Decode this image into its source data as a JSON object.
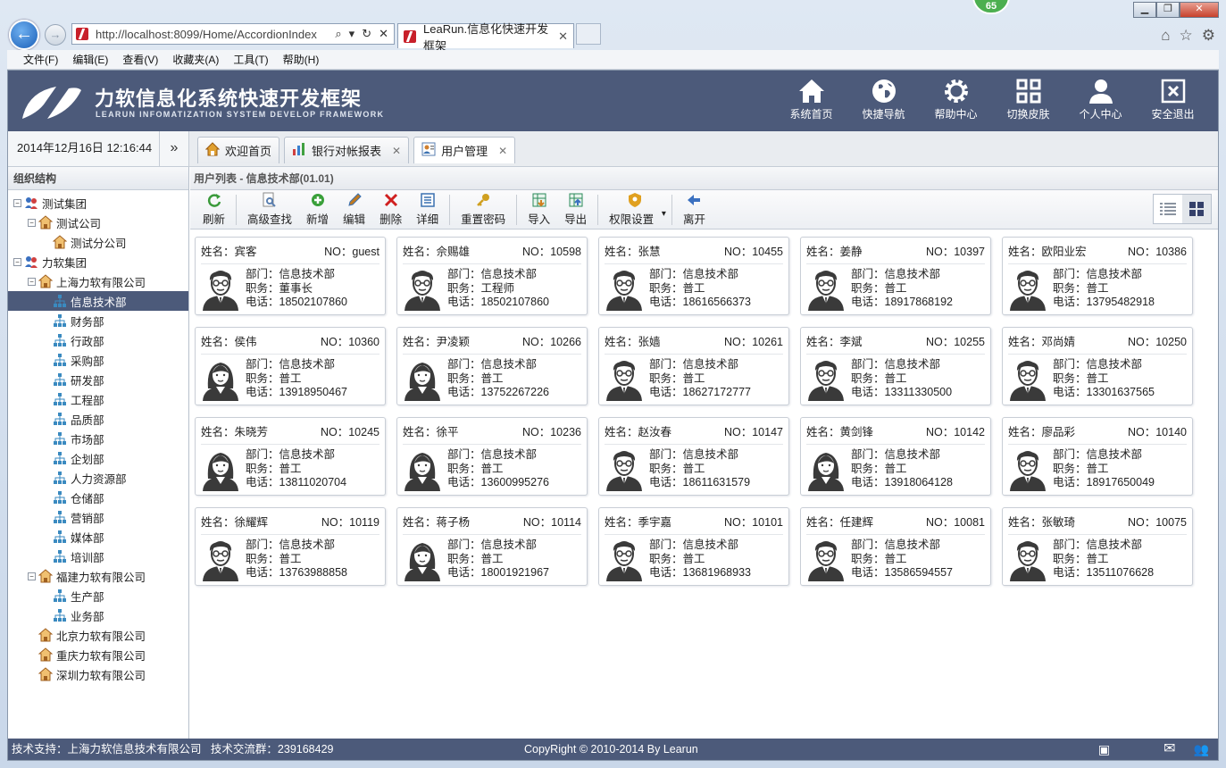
{
  "browser": {
    "url": "http://localhost:8099/Home/AccordionIndex",
    "tab_title": "LeaRun.信息化快速开发框架",
    "badge": "65",
    "menu": [
      "文件(F)",
      "编辑(E)",
      "查看(V)",
      "收藏夹(A)",
      "工具(T)",
      "帮助(H)"
    ]
  },
  "header": {
    "title": "力软信息化系统快速开发框架",
    "subtitle": "LEARUN INFOMATIZATION SYSTEM DEVELOP FRAMEWORK",
    "nav": [
      {
        "label": "系统首页",
        "icon": "home-icon"
      },
      {
        "label": "快捷导航",
        "icon": "globe-icon"
      },
      {
        "label": "帮助中心",
        "icon": "gear-icon"
      },
      {
        "label": "切换皮肤",
        "icon": "grid-icon"
      },
      {
        "label": "个人中心",
        "icon": "user-icon"
      },
      {
        "label": "安全退出",
        "icon": "exit-icon"
      }
    ]
  },
  "datetime": "2014年12月16日 12:16:44",
  "tabs": [
    {
      "label": "欢迎首页",
      "closable": false
    },
    {
      "label": "银行对帐报表",
      "closable": true
    },
    {
      "label": "用户管理",
      "closable": true
    }
  ],
  "sidebar": {
    "title": "组织结构",
    "nodes": [
      {
        "label": "测试集团",
        "level": 0,
        "toggle": "-",
        "type": "group"
      },
      {
        "label": "测试公司",
        "level": 1,
        "toggle": "-",
        "type": "company"
      },
      {
        "label": "测试分公司",
        "level": 2,
        "toggle": "",
        "type": "company"
      },
      {
        "label": "力软集团",
        "level": 0,
        "toggle": "-",
        "type": "group"
      },
      {
        "label": "上海力软有限公司",
        "level": 1,
        "toggle": "-",
        "type": "company"
      },
      {
        "label": "信息技术部",
        "level": 2,
        "toggle": "",
        "type": "dept",
        "selected": true
      },
      {
        "label": "财务部",
        "level": 2,
        "toggle": "",
        "type": "dept"
      },
      {
        "label": "行政部",
        "level": 2,
        "toggle": "",
        "type": "dept"
      },
      {
        "label": "采购部",
        "level": 2,
        "toggle": "",
        "type": "dept"
      },
      {
        "label": "研发部",
        "level": 2,
        "toggle": "",
        "type": "dept"
      },
      {
        "label": "工程部",
        "level": 2,
        "toggle": "",
        "type": "dept"
      },
      {
        "label": "品质部",
        "level": 2,
        "toggle": "",
        "type": "dept"
      },
      {
        "label": "市场部",
        "level": 2,
        "toggle": "",
        "type": "dept"
      },
      {
        "label": "企划部",
        "level": 2,
        "toggle": "",
        "type": "dept"
      },
      {
        "label": "人力资源部",
        "level": 2,
        "toggle": "",
        "type": "dept"
      },
      {
        "label": "仓储部",
        "level": 2,
        "toggle": "",
        "type": "dept"
      },
      {
        "label": "营销部",
        "level": 2,
        "toggle": "",
        "type": "dept"
      },
      {
        "label": "媒体部",
        "level": 2,
        "toggle": "",
        "type": "dept"
      },
      {
        "label": "培训部",
        "level": 2,
        "toggle": "",
        "type": "dept"
      },
      {
        "label": "福建力软有限公司",
        "level": 1,
        "toggle": "-",
        "type": "company"
      },
      {
        "label": "生产部",
        "level": 2,
        "toggle": "",
        "type": "dept"
      },
      {
        "label": "业务部",
        "level": 2,
        "toggle": "",
        "type": "dept"
      },
      {
        "label": "北京力软有限公司",
        "level": 1,
        "toggle": "",
        "type": "company"
      },
      {
        "label": "重庆力软有限公司",
        "level": 1,
        "toggle": "",
        "type": "company"
      },
      {
        "label": "深圳力软有限公司",
        "level": 1,
        "toggle": "",
        "type": "company"
      }
    ]
  },
  "breadcrumb": "用户列表 - 信息技术部(01.01)",
  "toolbar": [
    {
      "label": "刷新",
      "icon": "refresh-icon",
      "color": "#3a9a3a"
    },
    {
      "sep": true
    },
    {
      "label": "高级查找",
      "icon": "search-icon",
      "color": "#5a7fb0"
    },
    {
      "label": "新增",
      "icon": "add-icon",
      "color": "#3aa03a"
    },
    {
      "label": "编辑",
      "icon": "edit-icon",
      "color": "#c07a20"
    },
    {
      "label": "删除",
      "icon": "delete-icon",
      "color": "#d02020"
    },
    {
      "label": "详细",
      "icon": "detail-icon",
      "color": "#3a70b0"
    },
    {
      "sep": true
    },
    {
      "label": "重置密码",
      "icon": "key-icon",
      "color": "#d0a020"
    },
    {
      "sep": true
    },
    {
      "label": "导入",
      "icon": "import-icon",
      "color": "#2a8a5a"
    },
    {
      "label": "导出",
      "icon": "export-icon",
      "color": "#2a8a5a"
    },
    {
      "sep": true
    },
    {
      "label": "权限设置",
      "icon": "shield-icon",
      "color": "#e0a020",
      "dropdown": true
    },
    {
      "sep": true
    },
    {
      "label": "离开",
      "icon": "leave-icon",
      "color": "#3a70c0"
    }
  ],
  "labels": {
    "name": "姓名：",
    "no": "NO：",
    "dept": "部门：",
    "post": "职务：",
    "phone": "电话："
  },
  "users": [
    {
      "name": "宾客",
      "no": "guest",
      "dept": "信息技术部",
      "post": "董事长",
      "phone": "18502107860",
      "gender": "m"
    },
    {
      "name": "佘赐雄",
      "no": "10598",
      "dept": "信息技术部",
      "post": "工程师",
      "phone": "18502107860",
      "gender": "m"
    },
    {
      "name": "张慧",
      "no": "10455",
      "dept": "信息技术部",
      "post": "普工",
      "phone": "18616566373",
      "gender": "m"
    },
    {
      "name": "姜静",
      "no": "10397",
      "dept": "信息技术部",
      "post": "普工",
      "phone": "18917868192",
      "gender": "m"
    },
    {
      "name": "欧阳业宏",
      "no": "10386",
      "dept": "信息技术部",
      "post": "普工",
      "phone": "13795482918",
      "gender": "m"
    },
    {
      "name": "侯伟",
      "no": "10360",
      "dept": "信息技术部",
      "post": "普工",
      "phone": "13918950467",
      "gender": "f"
    },
    {
      "name": "尹凌颖",
      "no": "10266",
      "dept": "信息技术部",
      "post": "普工",
      "phone": "13752267226",
      "gender": "f"
    },
    {
      "name": "张嫱",
      "no": "10261",
      "dept": "信息技术部",
      "post": "普工",
      "phone": "18627172777",
      "gender": "m"
    },
    {
      "name": "李斌",
      "no": "10255",
      "dept": "信息技术部",
      "post": "普工",
      "phone": "13311330500",
      "gender": "m"
    },
    {
      "name": "邓尚婧",
      "no": "10250",
      "dept": "信息技术部",
      "post": "普工",
      "phone": "13301637565",
      "gender": "m"
    },
    {
      "name": "朱晓芳",
      "no": "10245",
      "dept": "信息技术部",
      "post": "普工",
      "phone": "13811020704",
      "gender": "f"
    },
    {
      "name": "徐平",
      "no": "10236",
      "dept": "信息技术部",
      "post": "普工",
      "phone": "13600995276",
      "gender": "f"
    },
    {
      "name": "赵汝春",
      "no": "10147",
      "dept": "信息技术部",
      "post": "普工",
      "phone": "18611631579",
      "gender": "m"
    },
    {
      "name": "黄剑锋",
      "no": "10142",
      "dept": "信息技术部",
      "post": "普工",
      "phone": "13918064128",
      "gender": "f"
    },
    {
      "name": "廖品彩",
      "no": "10140",
      "dept": "信息技术部",
      "post": "普工",
      "phone": "18917650049",
      "gender": "m"
    },
    {
      "name": "徐耀辉",
      "no": "10119",
      "dept": "信息技术部",
      "post": "普工",
      "phone": "13763988858",
      "gender": "m"
    },
    {
      "name": "蒋子杨",
      "no": "10114",
      "dept": "信息技术部",
      "post": "普工",
      "phone": "18001921967",
      "gender": "f"
    },
    {
      "name": "季宇嘉",
      "no": "10101",
      "dept": "信息技术部",
      "post": "普工",
      "phone": "13681968933",
      "gender": "m"
    },
    {
      "name": "任建辉",
      "no": "10081",
      "dept": "信息技术部",
      "post": "普工",
      "phone": "13586594557",
      "gender": "m"
    },
    {
      "name": "张敏琦",
      "no": "10075",
      "dept": "信息技术部",
      "post": "普工",
      "phone": "13511076628",
      "gender": "m"
    }
  ],
  "status": {
    "left": "技术支持：上海力软信息技术有限公司   技术交流群：239168429",
    "center": "CopyRight © 2010-2014 By Learun"
  },
  "colors": {
    "band": "#4c5a7a",
    "selected": "#4c5a7a"
  }
}
